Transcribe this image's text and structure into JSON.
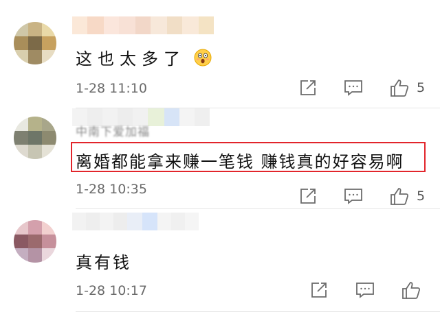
{
  "comments": [
    {
      "username_text": "",
      "text": "这也太多了",
      "time": "1-28 11:10",
      "likes": "5",
      "avatar_colors": [
        "#cfc7a8",
        "#c9b384",
        "#e9d9a8",
        "#a98e5a",
        "#7c6a48",
        "#c7a15f",
        "#d9cfae",
        "#9f8b63",
        "#e7dcc2"
      ],
      "name_colors": [
        "#fbe8d8",
        "#f7d9c6",
        "#fbe6dc",
        "#f8e1d6",
        "#f2d7c8",
        "#f7e8da",
        "#f1dec6",
        "#f9e9d9",
        "#f4e3c4"
      ]
    },
    {
      "username_text": "中南下爱加福",
      "text": "离婚都能拿来赚一笔钱  赚钱真的好容易啊",
      "time": "1-28 10:35",
      "likes": "5",
      "avatar_colors": [
        "#e8e8e0",
        "#b5b28a",
        "#a8a68a",
        "#7e8071",
        "#6e7668",
        "#8d8a70",
        "#dedad0",
        "#c7c5b3",
        "#e5e2d6"
      ],
      "name_colors": [
        "#f3f3f3",
        "#eeeeee",
        "#f2f2f2",
        "#ededed",
        "#f1f1f1",
        "#e8f1d9",
        "#d7e4f7",
        "#f4f4f4",
        "#efefef"
      ]
    },
    {
      "username_text": "",
      "text": "真有钱",
      "time": "1-28 10:17",
      "likes": "",
      "avatar_colors": [
        "#e7c7cb",
        "#d4a0ac",
        "#f2d0cf",
        "#8a5962",
        "#9b6a6d",
        "#c6909b",
        "#c4aec0",
        "#b493a5",
        "#ead7dd"
      ],
      "name_colors": [
        "#f2f2f2",
        "#eeeeee",
        "#f3f3f3",
        "#ededed",
        "#e9eef7",
        "#d6e4fa",
        "#f4f4f4",
        "#f0f0f0",
        "#f5f5f5"
      ]
    }
  ],
  "icons": {
    "share": "share-icon",
    "comment": "comment-icon",
    "like": "like-icon"
  },
  "colors": {
    "highlight_border": "#e2252b",
    "meta_text": "#6b6b6b"
  }
}
